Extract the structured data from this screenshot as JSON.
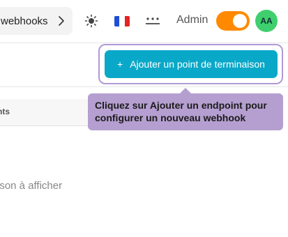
{
  "header": {
    "breadcrumb_text": "webhooks",
    "admin_label": "Admin",
    "avatar_initials": "AA",
    "icons": [
      "sun-icon",
      "flag-fr-icon",
      "more-icon",
      "chevron-right-icon"
    ]
  },
  "toolbar": {
    "add_endpoint_label": "Ajouter un point de terminaison",
    "plus": "+"
  },
  "tooltip": {
    "text": "Cliquez sur Ajouter un endpoint pour configurer un nouveau webhook"
  },
  "table": {
    "column_partial": "nts"
  },
  "empty_state": {
    "text": "ison à afficher"
  },
  "colors": {
    "accent": "#0aa8c8",
    "tooltip_bg": "#b59fd0",
    "toggle": "#ff8a00",
    "avatar": "#3fcf6e"
  }
}
